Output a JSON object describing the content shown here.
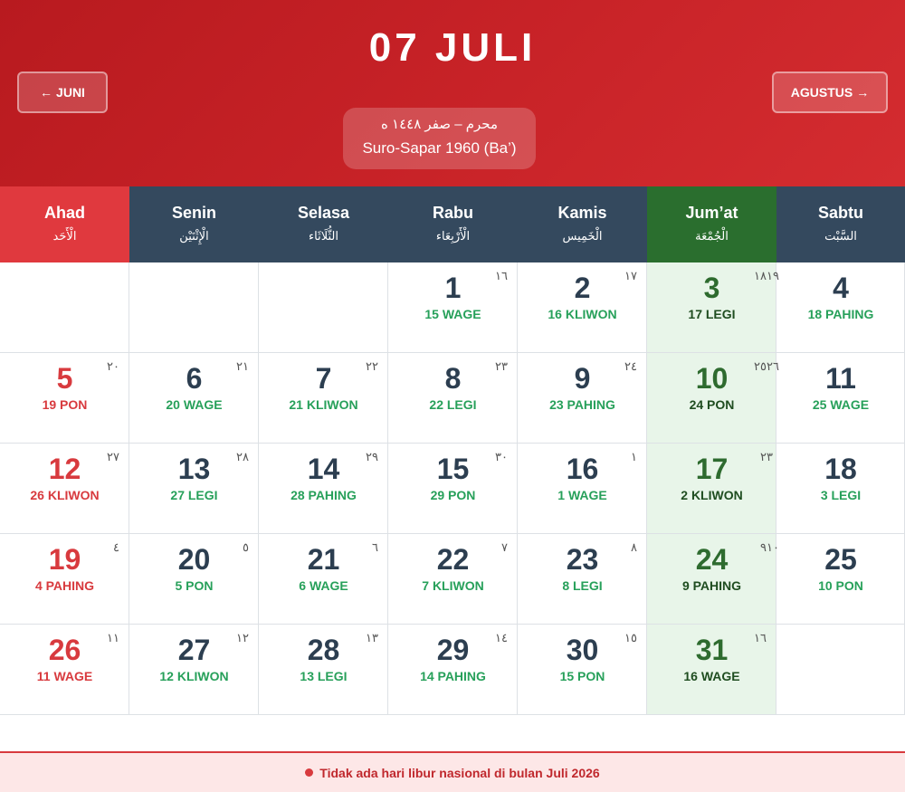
{
  "header": {
    "title": "07 JULI",
    "prev_label": "JUNI",
    "next_label": "AGUSTUS",
    "prev_arrow": "←",
    "next_arrow": "→",
    "hijri_period": "محرم – صفر ١٤٤٨ ه",
    "javanese_period": "Suro-Sapar 1960 (Ba’)",
    "colors": {
      "header_red": "#c72227",
      "sunday_red": "#d83a3e",
      "weekday_navy": "#34495e",
      "friday_green": "#2a6e2e"
    }
  },
  "days": [
    {
      "name": "Ahad",
      "arabic": "الْأَحَد"
    },
    {
      "name": "Senin",
      "arabic": "الْإِثْنَيْن"
    },
    {
      "name": "Selasa",
      "arabic": "الثُّلَاثَاء"
    },
    {
      "name": "Rabu",
      "arabic": "الْأَرْبِعَاء"
    },
    {
      "name": "Kamis",
      "arabic": "الْخَمِيس"
    },
    {
      "name": "Jum’at",
      "arabic": "الْجُمْعَة"
    },
    {
      "name": "Sabtu",
      "arabic": "السَّبْت"
    }
  ],
  "weeks": [
    [
      null,
      null,
      null,
      {
        "day": "1",
        "javanese": "15 WAGE",
        "hijri": "١٦"
      },
      {
        "day": "2",
        "javanese": "16 KLIWON",
        "hijri": "١٧"
      },
      {
        "day": "3",
        "javanese": "17 LEGI",
        "hijri": "١٨"
      },
      {
        "day": "4",
        "javanese": "18 PAHING",
        "hijri": "١٩"
      }
    ],
    [
      {
        "day": "5",
        "javanese": "19 PON",
        "hijri": "٢٠"
      },
      {
        "day": "6",
        "javanese": "20 WAGE",
        "hijri": "٢١"
      },
      {
        "day": "7",
        "javanese": "21 KLIWON",
        "hijri": "٢٢"
      },
      {
        "day": "8",
        "javanese": "22 LEGI",
        "hijri": "٢٣"
      },
      {
        "day": "9",
        "javanese": "23 PAHING",
        "hijri": "٢٤"
      },
      {
        "day": "10",
        "javanese": "24 PON",
        "hijri": "٢٥"
      },
      {
        "day": "11",
        "javanese": "25 WAGE",
        "hijri": "٢٦"
      }
    ],
    [
      {
        "day": "12",
        "javanese": "26 KLIWON",
        "hijri": "٢٧"
      },
      {
        "day": "13",
        "javanese": "27 LEGI",
        "hijri": "٢٨"
      },
      {
        "day": "14",
        "javanese": "28 PAHING",
        "hijri": "٢٩"
      },
      {
        "day": "15",
        "javanese": "29 PON",
        "hijri": "٣٠"
      },
      {
        "day": "16",
        "javanese": "1 WAGE",
        "hijri": "١"
      },
      {
        "day": "17",
        "javanese": "2 KLIWON",
        "hijri": "٢"
      },
      {
        "day": "18",
        "javanese": "3 LEGI",
        "hijri": "٣"
      }
    ],
    [
      {
        "day": "19",
        "javanese": "4 PAHING",
        "hijri": "٤"
      },
      {
        "day": "20",
        "javanese": "5 PON",
        "hijri": "٥"
      },
      {
        "day": "21",
        "javanese": "6 WAGE",
        "hijri": "٦"
      },
      {
        "day": "22",
        "javanese": "7 KLIWON",
        "hijri": "٧"
      },
      {
        "day": "23",
        "javanese": "8 LEGI",
        "hijri": "٨"
      },
      {
        "day": "24",
        "javanese": "9 PAHING",
        "hijri": "٩"
      },
      {
        "day": "25",
        "javanese": "10 PON",
        "hijri": "١٠"
      }
    ],
    [
      {
        "day": "26",
        "javanese": "11 WAGE",
        "hijri": "١١"
      },
      {
        "day": "27",
        "javanese": "12 KLIWON",
        "hijri": "١٢"
      },
      {
        "day": "28",
        "javanese": "13 LEGI",
        "hijri": "١٣"
      },
      {
        "day": "29",
        "javanese": "14 PAHING",
        "hijri": "١٤"
      },
      {
        "day": "30",
        "javanese": "15 PON",
        "hijri": "١٥"
      },
      {
        "day": "31",
        "javanese": "16 WAGE",
        "hijri": "١٦"
      },
      null
    ]
  ],
  "footer": {
    "note": "Tidak ada hari libur nasional di bulan Juli 2026"
  }
}
